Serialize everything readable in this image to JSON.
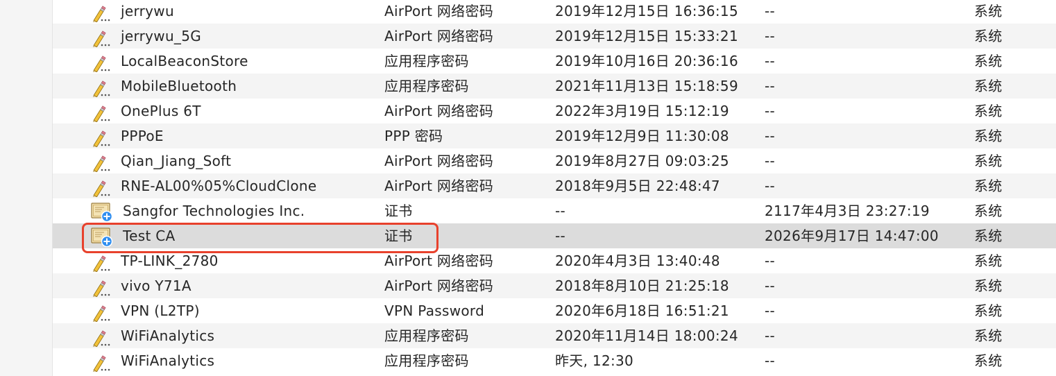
{
  "rows": [
    {
      "icon": "pencil-icon",
      "name": "jerrywu",
      "kind": "AirPort 网络密码",
      "modified": "2019年12月15日 16:36:15",
      "expires": "--",
      "keychain": "系统"
    },
    {
      "icon": "pencil-icon",
      "name": "jerrywu_5G",
      "kind": "AirPort 网络密码",
      "modified": "2019年12月15日 15:33:21",
      "expires": "--",
      "keychain": "系统"
    },
    {
      "icon": "pencil-icon",
      "name": "LocalBeaconStore",
      "kind": "应用程序密码",
      "modified": "2019年10月16日 20:36:16",
      "expires": "--",
      "keychain": "系统"
    },
    {
      "icon": "pencil-icon",
      "name": "MobileBluetooth",
      "kind": "应用程序密码",
      "modified": "2021年11月13日 15:18:59",
      "expires": "--",
      "keychain": "系统"
    },
    {
      "icon": "pencil-icon",
      "name": "OnePlus 6T",
      "kind": "AirPort 网络密码",
      "modified": "2022年3月19日 15:12:19",
      "expires": "--",
      "keychain": "系统"
    },
    {
      "icon": "pencil-icon",
      "name": "PPPoE",
      "kind": "PPP 密码",
      "modified": "2019年12月9日 11:30:08",
      "expires": "--",
      "keychain": "系统"
    },
    {
      "icon": "pencil-icon",
      "name": "Qian_Jiang_Soft",
      "kind": "AirPort 网络密码",
      "modified": "2019年8月27日 09:03:25",
      "expires": "--",
      "keychain": "系统"
    },
    {
      "icon": "pencil-icon",
      "name": "RNE-AL00%05%CloudClone",
      "kind": "AirPort 网络密码",
      "modified": "2018年9月5日 22:48:47",
      "expires": "--",
      "keychain": "系统"
    },
    {
      "icon": "certificate-icon",
      "name": "Sangfor Technologies Inc.",
      "kind": "证书",
      "modified": "--",
      "expires": "2117年4月3日 23:27:19",
      "keychain": "系统"
    },
    {
      "icon": "certificate-icon",
      "name": "Test CA",
      "kind": "证书",
      "modified": "--",
      "expires": "2026年9月17日 14:47:00",
      "keychain": "系统",
      "selected": true
    },
    {
      "icon": "pencil-icon",
      "name": "TP-LINK_2780",
      "kind": "AirPort 网络密码",
      "modified": "2020年4月3日 13:40:48",
      "expires": "--",
      "keychain": "系统"
    },
    {
      "icon": "pencil-icon",
      "name": "vivo Y71A",
      "kind": "AirPort 网络密码",
      "modified": "2018年8月10日 21:25:18",
      "expires": "--",
      "keychain": "系统"
    },
    {
      "icon": "pencil-icon",
      "name": "VPN (L2TP)",
      "kind": "VPN Password",
      "modified": "2020年6月18日 16:51:21",
      "expires": "--",
      "keychain": "系统"
    },
    {
      "icon": "pencil-icon",
      "name": "WiFiAnalytics",
      "kind": "应用程序密码",
      "modified": "2020年11月14日 18:00:24",
      "expires": "--",
      "keychain": "系统"
    },
    {
      "icon": "pencil-icon",
      "name": "WiFiAnalytics",
      "kind": "应用程序密码",
      "modified": "昨天, 12:30",
      "expires": "--",
      "keychain": "系统"
    }
  ],
  "colors": {
    "highlight_border": "#e8412c",
    "selected_row": "#dcdcdc",
    "alt_row": "#f4f4f4"
  }
}
